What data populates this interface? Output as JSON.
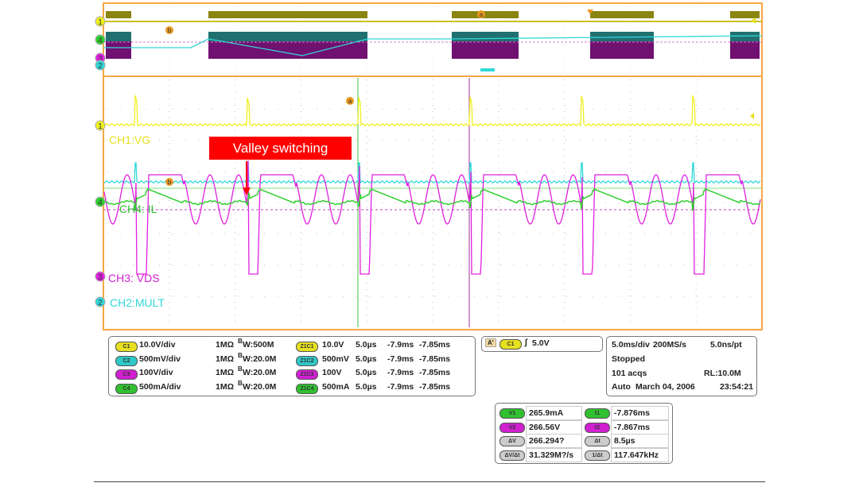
{
  "colors": {
    "ch1": "#f0f020",
    "ch2": "#30d8d8",
    "ch3": "#e020e0",
    "ch4": "#30d030",
    "frame": "#f5a742",
    "callout": "#ff0000"
  },
  "waveform_labels": {
    "ch1": "CH1:VG",
    "ch4": "CH4: IL",
    "ch3": "CH3: VDS",
    "ch2": "CH2:MULT"
  },
  "channel_markers": [
    "1",
    "2",
    "3",
    "4"
  ],
  "cursor_markers": [
    "a",
    "b"
  ],
  "annotation": "Valley switching",
  "channels": [
    {
      "badge": "C1",
      "scale": "10.0V/div",
      "impedance": "1MΩ",
      "bw_prefix": "B",
      "bw": "W:500M",
      "zoom_badge": "Z1C1",
      "zoom_scale": "10.0V",
      "zoom_time": "5.0µs",
      "zoom_pos": "-7.9ms",
      "zoom_pos2": "-7.85ms",
      "color": "#e6e020"
    },
    {
      "badge": "C2",
      "scale": "500mV/div",
      "impedance": "1MΩ",
      "bw_prefix": "B",
      "bw": "W:20.0M",
      "zoom_badge": "Z1C2",
      "zoom_scale": "500mV",
      "zoom_time": "5.0µs",
      "zoom_pos": "-7.9ms",
      "zoom_pos2": "-7.85ms",
      "color": "#30c8c8"
    },
    {
      "badge": "C3",
      "scale": "100V/div",
      "impedance": "1MΩ",
      "bw_prefix": "B",
      "bw": "W:20.0M",
      "zoom_badge": "Z1C3",
      "zoom_scale": "100V",
      "zoom_time": "5.0µs",
      "zoom_pos": "-7.9ms",
      "zoom_pos2": "-7.85ms",
      "color": "#d020d0"
    },
    {
      "badge": "C4",
      "scale": "500mA/div",
      "impedance": "1MΩ",
      "bw_prefix": "B",
      "bw": "W:20.0M",
      "zoom_badge": "Z1C4",
      "zoom_scale": "500mA",
      "zoom_time": "5.0µs",
      "zoom_pos": "-7.9ms",
      "zoom_pos2": "-7.85ms",
      "color": "#30c030"
    }
  ],
  "trigger": {
    "mode_badge": "A'",
    "source": "C1",
    "slope_icon": "rising-edge",
    "level": "5.0V"
  },
  "acquisition": {
    "timebase": "5.0ms/div",
    "sample_rate": "200MS/s",
    "resolution": "5.0ns/pt",
    "state": "Stopped",
    "acqs": "101 acqs",
    "record_length": "RL:10.0M",
    "trigger_mode": "Auto",
    "date": "March 04, 2006",
    "time": "23:54:21"
  },
  "measurements": [
    {
      "label": "V1",
      "value": "265.9mA",
      "label2": "t1",
      "value2": "-7.876ms",
      "color": "#30c030"
    },
    {
      "label": "V2",
      "value": "266.56V",
      "label2": "t2",
      "value2": "-7.867ms",
      "color": "#d020d0"
    },
    {
      "label": "ΔV",
      "value": "266.294?",
      "label2": "Δt",
      "value2": "8.5µs",
      "color": "#ccc"
    },
    {
      "label": "ΔV/Δt",
      "value": "31.329M?/s",
      "label2": "1/Δt",
      "value2": "117.647kHz",
      "color": "#ccc"
    }
  ]
}
